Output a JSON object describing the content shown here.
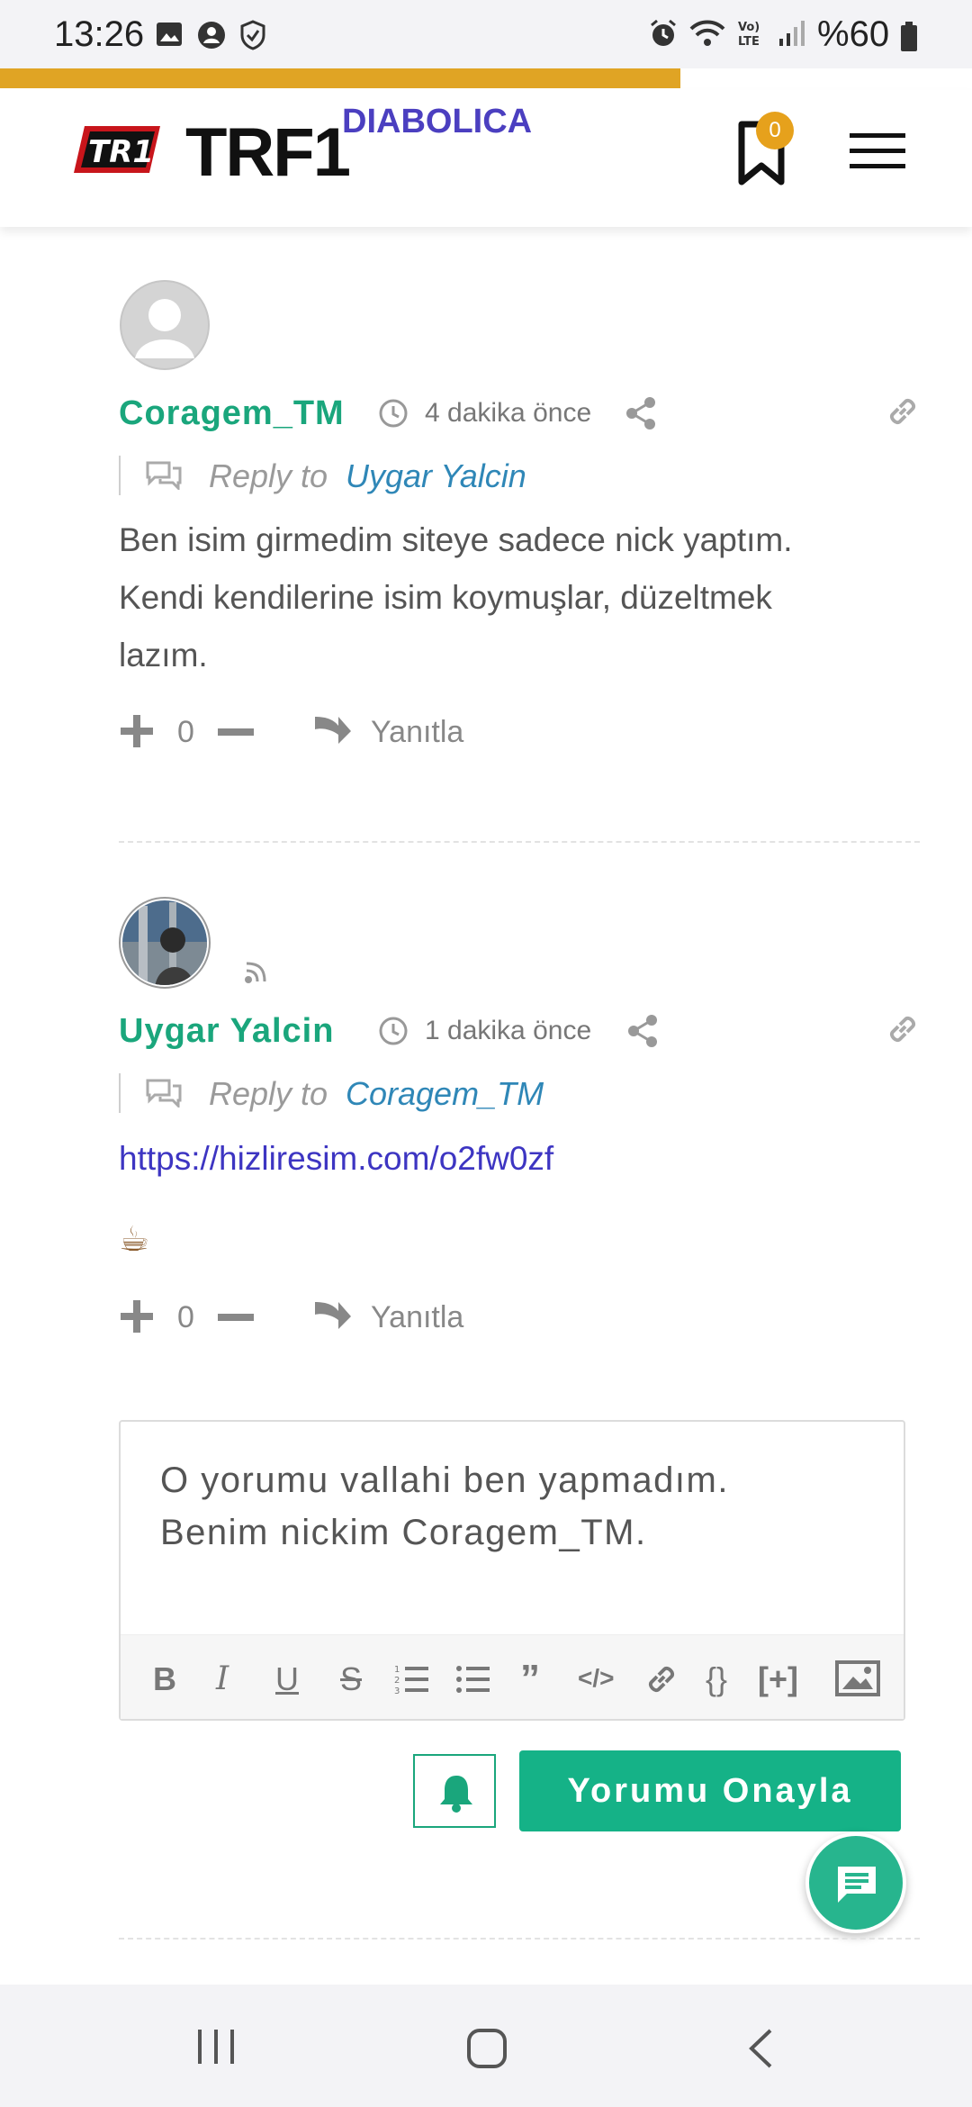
{
  "status_bar": {
    "time": "13:26",
    "battery": "%60"
  },
  "reading_progress_percent": 70,
  "header": {
    "logo_text": "TRF1",
    "logo_sub": "DIABOLICA",
    "bookmark_count": "0"
  },
  "comments": [
    {
      "author": "Coragem_TM",
      "time": "4 dakika önce",
      "reply_to_label": "Reply to",
      "reply_to_name": "Uygar Yalcin",
      "lines": [
        "Ben isim girmedim siteye sadece nick yaptım.",
        "Kendi kendilerine isim koymuşlar, düzeltmek",
        "lazım."
      ],
      "votes": "0",
      "reply_label": "Yanıtla"
    },
    {
      "author": "Uygar Yalcin",
      "time": "1 dakika önce",
      "reply_to_label": "Reply to",
      "reply_to_name": "Coragem_TM",
      "link": "https://hizliresim.com/o2fw0zf",
      "emoji": "☕",
      "votes": "0",
      "reply_label": "Yanıtla"
    }
  ],
  "editor": {
    "text_line1": "O yorumu vallahi ben yapmadım.",
    "text_line2": "Benim nickim Coragem_TM."
  },
  "submit_label": "Yorumu Onayla",
  "colors": {
    "accent": "#15b287",
    "author": "#1aa67c",
    "progress": "#e0a424",
    "link": "#3d35c2"
  }
}
